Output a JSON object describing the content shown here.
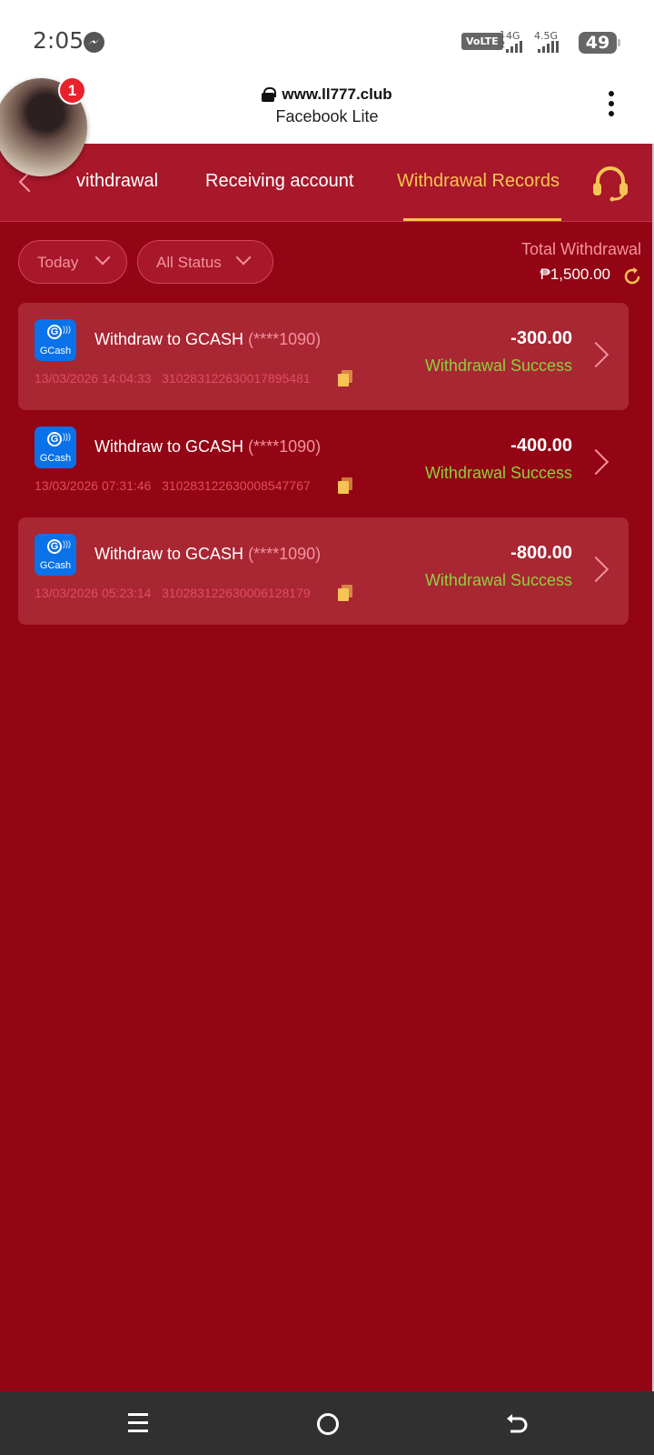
{
  "status_bar": {
    "time": "2:05",
    "volte": "VoLTE",
    "sim_slots": [
      "1",
      "2"
    ],
    "network_1": "4G",
    "network_2": "4.5G",
    "battery": "49"
  },
  "browser": {
    "url": "www.ll777.club",
    "app_name": "Facebook Lite"
  },
  "chat_head": {
    "badge_count": "1"
  },
  "tabs": [
    {
      "label": "vithdrawal"
    },
    {
      "label": "Receiving account"
    },
    {
      "label": "Withdrawal Records",
      "active": true
    }
  ],
  "filters": {
    "date": "Today",
    "status": "All Status"
  },
  "summary": {
    "label": "Total Withdrawal",
    "value": "₱1,500.00"
  },
  "records": [
    {
      "title": "Withdraw to GCASH",
      "account": "(****1090)",
      "datetime": "13/03/2026 14:04:33",
      "order_id": "3102831226300178954 81",
      "amount": "-300.00",
      "status": "Withdrawal Success",
      "logo_text": "GCash"
    },
    {
      "title": "Withdraw to GCASH",
      "account": "(****1090)",
      "datetime": "13/03/2026 07:31:46",
      "order_id": "310283122630008547767",
      "amount": "-400.00",
      "status": "Withdrawal Success",
      "logo_text": "GCash"
    },
    {
      "title": "Withdraw to GCASH",
      "account": "(****1090)",
      "datetime": "13/03/2026 05:23:14",
      "order_id": "310283122630006128179",
      "amount": "-800.00",
      "status": "Withdrawal Success",
      "logo_text": "GCash"
    }
  ],
  "colors": {
    "background": "#930414",
    "card": "#a92633",
    "accent": "#f7c454",
    "success": "#8fcf3f",
    "muted": "#f3939e"
  }
}
